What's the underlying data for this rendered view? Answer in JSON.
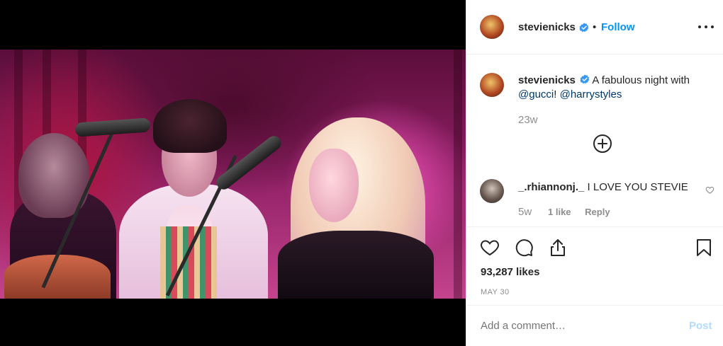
{
  "post": {
    "username": "stevienicks",
    "verified": true,
    "follow_label": "Follow",
    "separator": "•",
    "more_icon": "more-horizontal-icon"
  },
  "caption": {
    "username": "stevienicks",
    "text_before": " A fabulous night with",
    "mention_1": "@gucci",
    "text_mid": "! ",
    "mention_2": "@harrystyles",
    "age": "23w",
    "load_more_icon": "plus-circle-icon"
  },
  "comments": [
    {
      "username": "_.rhiannonj._",
      "text": "I LOVE YOU STEVIE",
      "age": "5w",
      "likes": "1 like",
      "reply_label": "Reply",
      "like_icon": "heart-outline-icon"
    }
  ],
  "actions": {
    "icons": [
      "heart-icon",
      "comment-icon",
      "share-icon",
      "bookmark-icon"
    ],
    "likes_count": "93,287 likes",
    "date": "MAY 30"
  },
  "composer": {
    "placeholder": "Add a comment…",
    "post_label": "Post"
  },
  "colors": {
    "accent": "#0095f6",
    "mention": "#00376b",
    "muted": "#8e8e8e",
    "post_disabled": "#b3dbff"
  }
}
